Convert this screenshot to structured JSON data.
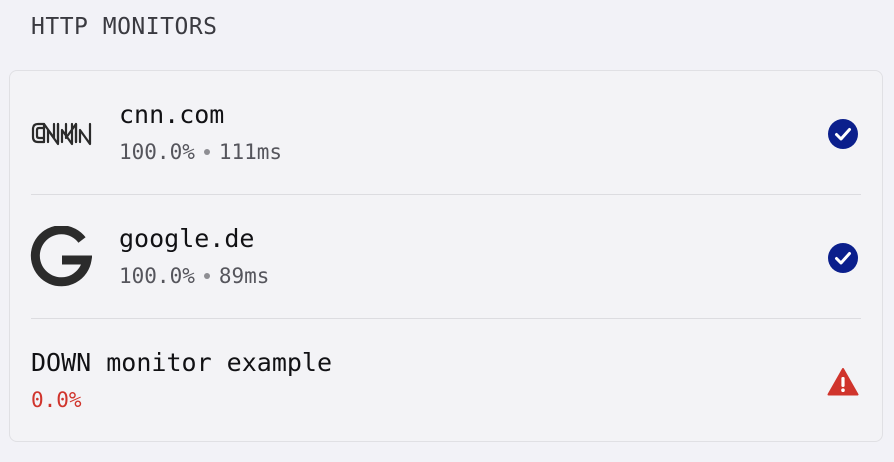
{
  "section": {
    "title": "HTTP MONITORS"
  },
  "monitors": [
    {
      "name": "cnn.com",
      "uptime": "100.0%",
      "latency": "111ms",
      "logo": "cnn-logo",
      "status": "up",
      "status_icon": "check-circle-icon"
    },
    {
      "name": "google.de",
      "uptime": "100.0%",
      "latency": "89ms",
      "logo": "google-logo",
      "status": "up",
      "status_icon": "check-circle-icon"
    },
    {
      "name": "DOWN monitor example",
      "uptime": "0.0%",
      "status": "down",
      "status_icon": "warning-triangle-icon"
    }
  ],
  "colors": {
    "up": "#0b1f8c",
    "down": "#d0342c",
    "background": "#f2f2f7"
  }
}
